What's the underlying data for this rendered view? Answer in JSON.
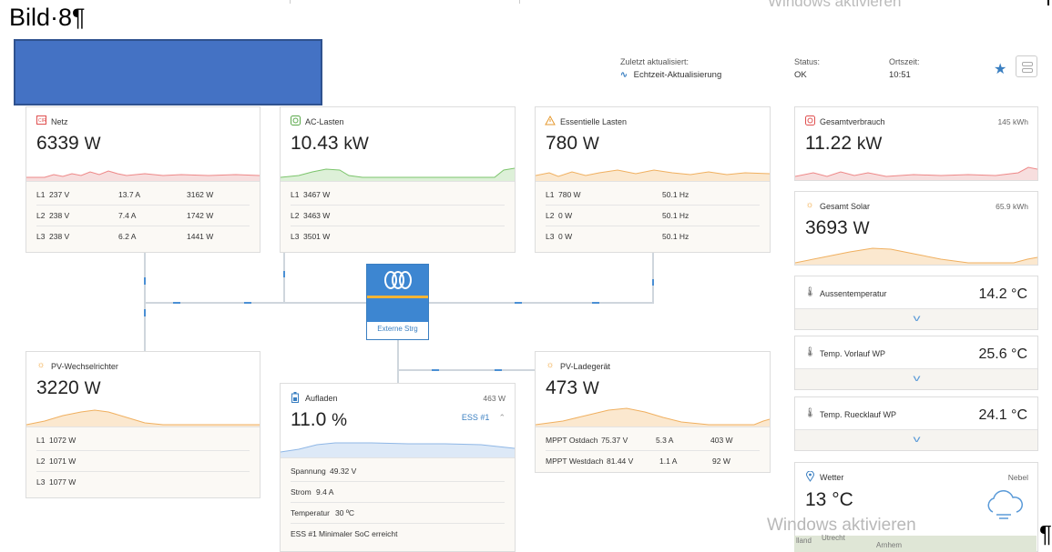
{
  "document": {
    "caption": "Bild·8¶",
    "pilcrow": "¶"
  },
  "watermark": {
    "top_text": "Windows aktivieren",
    "bottom_text": "Windows aktivieren"
  },
  "header": {
    "updated_label": "Zuletzt aktualisiert:",
    "updated_value": "Echtzeit-Aktualisierung",
    "status_label": "Status:",
    "status_value": "OK",
    "time_label": "Ortszeit:",
    "time_value": "10:51"
  },
  "grid": {
    "title": "Netz",
    "value": "6339",
    "unit": "W",
    "rows": [
      {
        "phase": "L1",
        "v": "237 V",
        "a": "13.7 A",
        "w": "3162 W"
      },
      {
        "phase": "L2",
        "v": "238 V",
        "a": "7.4 A",
        "w": "1742 W"
      },
      {
        "phase": "L3",
        "v": "238 V",
        "a": "6.2 A",
        "w": "1441 W"
      }
    ]
  },
  "ac_loads": {
    "title": "AC-Lasten",
    "value": "10.43",
    "unit": "kW",
    "rows": [
      {
        "phase": "L1",
        "w": "3467 W"
      },
      {
        "phase": "L2",
        "w": "3463 W"
      },
      {
        "phase": "L3",
        "w": "3501 W"
      }
    ]
  },
  "essential_loads": {
    "title": "Essentielle Lasten",
    "value": "780",
    "unit": "W",
    "rows": [
      {
        "phase": "L1",
        "w": "780 W",
        "hz": "50.1 Hz"
      },
      {
        "phase": "L2",
        "w": "0 W",
        "hz": "50.1 Hz"
      },
      {
        "phase": "L3",
        "w": "0 W",
        "hz": "50.1 Hz"
      }
    ]
  },
  "inverter": {
    "label": "Externe Strg"
  },
  "pv_inverter": {
    "title": "PV-Wechselrichter",
    "value": "3220",
    "unit": "W",
    "rows": [
      {
        "phase": "L1",
        "w": "1072 W"
      },
      {
        "phase": "L2",
        "w": "1071 W"
      },
      {
        "phase": "L3",
        "w": "1077 W"
      }
    ]
  },
  "battery": {
    "title": "Aufladen",
    "power": "463 W",
    "value": "11.0",
    "unit": "%",
    "ess_link": "ESS #1",
    "rows": [
      {
        "label": "Spannung",
        "value": "49.32 V"
      },
      {
        "label": "Strom",
        "value": "9.4 A"
      },
      {
        "label": "Temperatur",
        "value": "30 ºC"
      },
      {
        "label": "ESS #1",
        "value": "Minimaler SoC erreicht"
      }
    ]
  },
  "pv_charger": {
    "title": "PV-Ladegerät",
    "value": "473",
    "unit": "W",
    "rows": [
      {
        "name": "MPPT Ostdach",
        "v": "75.37 V",
        "a": "5.3 A",
        "w": "403 W"
      },
      {
        "name": "MPPT Westdach",
        "v": "81.44 V",
        "a": "1.1 A",
        "w": "92 W"
      }
    ]
  },
  "total_consumption": {
    "title": "Gesamtverbrauch",
    "energy": "145 kWh",
    "value": "11.22",
    "unit": "kW"
  },
  "total_solar": {
    "title": "Gesamt Solar",
    "energy": "65.9 kWh",
    "value": "3693",
    "unit": "W"
  },
  "temps": [
    {
      "title": "Aussentemperatur",
      "value": "14.2 °C"
    },
    {
      "title": "Temp. Vorlauf WP",
      "value": "25.6 °C"
    },
    {
      "title": "Temp. Ruecklauf WP",
      "value": "24.1 °C"
    }
  ],
  "weather": {
    "title": "Wetter",
    "condition": "Nebel",
    "value": "13 °C"
  },
  "map_labels": [
    "lland",
    "Utrecht",
    "Arnhem"
  ],
  "colors": {
    "accent": "#3a7fc1",
    "grid": "#e88",
    "ac": "#7bc46b",
    "solar": "#f0b060",
    "battery": "#8fb7e6"
  },
  "icons": {
    "grid": "grid-icon",
    "ac": "ac-loads-icon",
    "essential": "warning-icon",
    "solar": "sun-icon",
    "battery": "battery-icon",
    "thermo": "thermometer-icon",
    "weather": "location-pin-icon",
    "cloud": "fog-cloud-icon",
    "star": "star-icon"
  }
}
